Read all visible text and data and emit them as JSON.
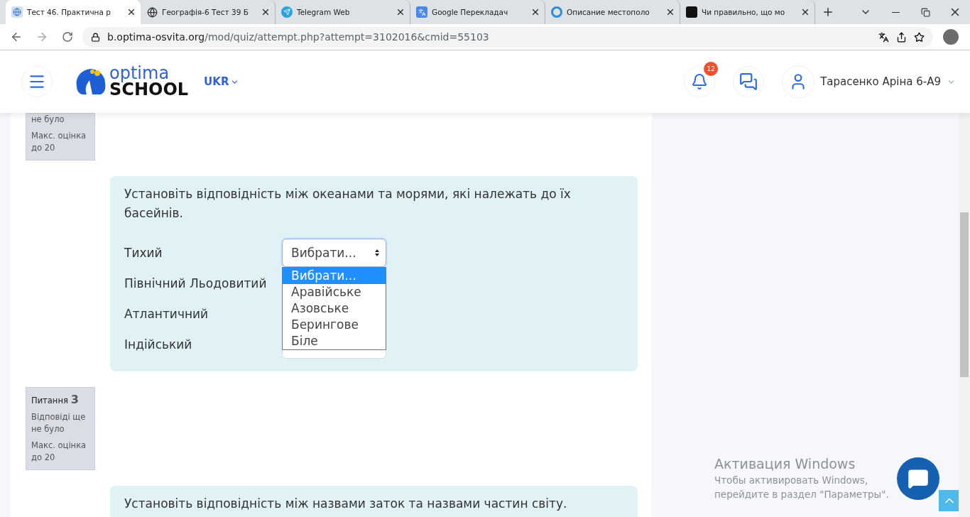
{
  "browser": {
    "tabs": [
      {
        "title": "Тест 46. Практична р",
        "selected": true
      },
      {
        "title": "Географія-6 Тест 39 Б",
        "selected": false
      },
      {
        "title": "Telegram Web",
        "selected": false
      },
      {
        "title": "Google Перекладач",
        "selected": false
      },
      {
        "title": "Описание местополо",
        "selected": false
      },
      {
        "title": "Чи правильно, що мо",
        "selected": false
      }
    ],
    "url_host": "b.optima-osvita.org",
    "url_path": "/mod/quiz/attempt.php?attempt=3102016&cmid=55103"
  },
  "header": {
    "logo_top": "optima",
    "logo_bottom": "SCHOOL",
    "language": "UKR",
    "notifications_count": "12",
    "user_name": "Тарасенко Аріна 6-А9"
  },
  "questions": [
    {
      "info": {
        "status": "не було",
        "grade": "Макс. оцінка до 20"
      },
      "text": "Установіть відповідність між океанами та морями, які належать до їх басейнів.",
      "rows": [
        {
          "label": "Тихий",
          "value": "Вибрати..."
        },
        {
          "label": "Північний Льодовитий"
        },
        {
          "label": "Атлантичний"
        },
        {
          "label": "Індійський"
        }
      ],
      "dropdown": [
        {
          "label": "Вибрати...",
          "selected": true
        },
        {
          "label": "Аравійське",
          "selected": false
        },
        {
          "label": "Азовське",
          "selected": false
        },
        {
          "label": "Берингове",
          "selected": false
        },
        {
          "label": "Біле",
          "selected": false
        }
      ]
    },
    {
      "info": {
        "title": "Питання",
        "number": "3",
        "status": "Відповіді ще не було",
        "grade": "Макс. оцінка до 20"
      },
      "text": "Установіть відповідність між назвами заток та назвами частин світу."
    }
  ],
  "activation": {
    "title": "Активация Windows",
    "text": "Чтобы активировать Windows, перейдите в раздел \"Параметры\"."
  }
}
